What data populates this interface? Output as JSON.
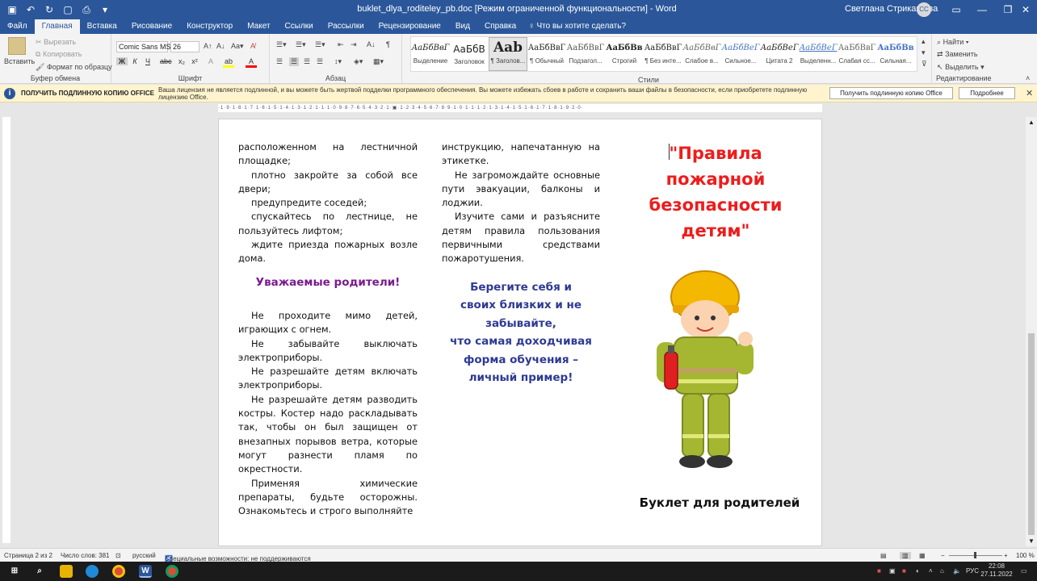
{
  "titlebar": {
    "title": "buklet_dlya_roditeley_pb.doc [Режим ограниченной функциональности] - Word",
    "user": "Светлана Стрикашова",
    "initials": "СС"
  },
  "tabs": [
    "Файл",
    "Главная",
    "Вставка",
    "Рисование",
    "Конструктор",
    "Макет",
    "Ссылки",
    "Рассылки",
    "Рецензирование",
    "Вид",
    "Справка"
  ],
  "tell_me": "Что вы хотите сделать?",
  "ribbon": {
    "clipboard": {
      "paste": "Вставить",
      "cut": "Вырезать",
      "copy": "Копировать",
      "painter": "Формат по образцу",
      "label": "Буфер обмена"
    },
    "font": {
      "name": "Comic Sans MS",
      "size": "26",
      "label": "Шрифт"
    },
    "paragraph_label": "Абзац",
    "styles": [
      {
        "preview": "АаБбВвГ",
        "name": "Выделение"
      },
      {
        "preview": "АаБбВ",
        "name": "Заголовок"
      },
      {
        "preview": "Aab",
        "name": "¶ Заголов..."
      },
      {
        "preview": "АаБбВвГ",
        "name": "¶ Обычный"
      },
      {
        "preview": "АаБбВвГ",
        "name": "Подзагол..."
      },
      {
        "preview": "АаБбВв",
        "name": "Строгий"
      },
      {
        "preview": "АаБбВвГ",
        "name": "¶ Без инте..."
      },
      {
        "preview": "АаБбВвГ",
        "name": "Слабое в..."
      },
      {
        "preview": "АаБбВеГ",
        "name": "Сильное..."
      },
      {
        "preview": "АаБбВеГ",
        "name": "Цитата 2"
      },
      {
        "preview": "АаБбВеГ",
        "name": "Выделенн..."
      },
      {
        "preview": "АаБбВвГ",
        "name": "Слабая сс..."
      },
      {
        "preview": "АаБбВв",
        "name": "Сильная..."
      }
    ],
    "styles_label": "Стили",
    "editing": {
      "find": "Найти",
      "replace": "Заменить",
      "select": "Выделить",
      "label": "Редактирование"
    }
  },
  "message_bar": {
    "title": "ПОЛУЧИТЬ ПОДЛИННУЮ КОПИЮ OFFICE",
    "text": "Ваша лицензия не является подлинной, и вы можете быть жертвой подделки программного обеспечения. Вы можете избежать сбоев в работе и сохранить ваши файлы в безопасности, если приобретете подлинную лицензию Office.",
    "button_get": "Получить подлинную копию Office",
    "button_more": "Подробнее"
  },
  "document": {
    "col1": [
      "расположенном на лестничной площадке;",
      "плотно закройте за собой все двери;",
      "предупредите соседей;",
      "спускайтесь по лестнице, не пользуйтесь лифтом;",
      "ждите приезда пожарных возле дома."
    ],
    "col1_heading": "Уважаемые родители!",
    "col1_b": [
      "Не проходите мимо детей, играющих с огнем.",
      "Не забывайте выключать электроприборы.",
      "Не разрешайте детям включать электроприборы.",
      "Не разрешайте детям разводить костры. Костер надо раскладывать так, чтобы он был защищен от внезапных порывов ветра, которые могут разнести пламя по окрестности.",
      "Применяя химические препараты, будьте осторожны. Ознакомьтесь и строго выполняйте"
    ],
    "col2": [
      "инструкцию, напечатанную на этикетке.",
      "Не загромождайте основные пути эвакуации, балконы и лоджии.",
      "Изучите сами и разъясните детям правила пользования первичными средствами пожаротушения."
    ],
    "col2_blue": [
      "Берегите себя и",
      "своих близких и не",
      "забывайте,",
      "что самая доходчивая",
      "форма обучения –",
      "личный пример!"
    ],
    "cover_title": "\"Правила пожарной безопасности детям\"",
    "cover_sub": "Буклет для родителей"
  },
  "status": {
    "page": "Страница 2 из 2",
    "words": "Число слов: 381",
    "lang": "русский",
    "accessibility": "Специальные возможности: не поддерживаются",
    "zoom": "100 %"
  },
  "taskbar": {
    "time": "22:08",
    "date": "27.11.2022",
    "lang": "РУС"
  }
}
